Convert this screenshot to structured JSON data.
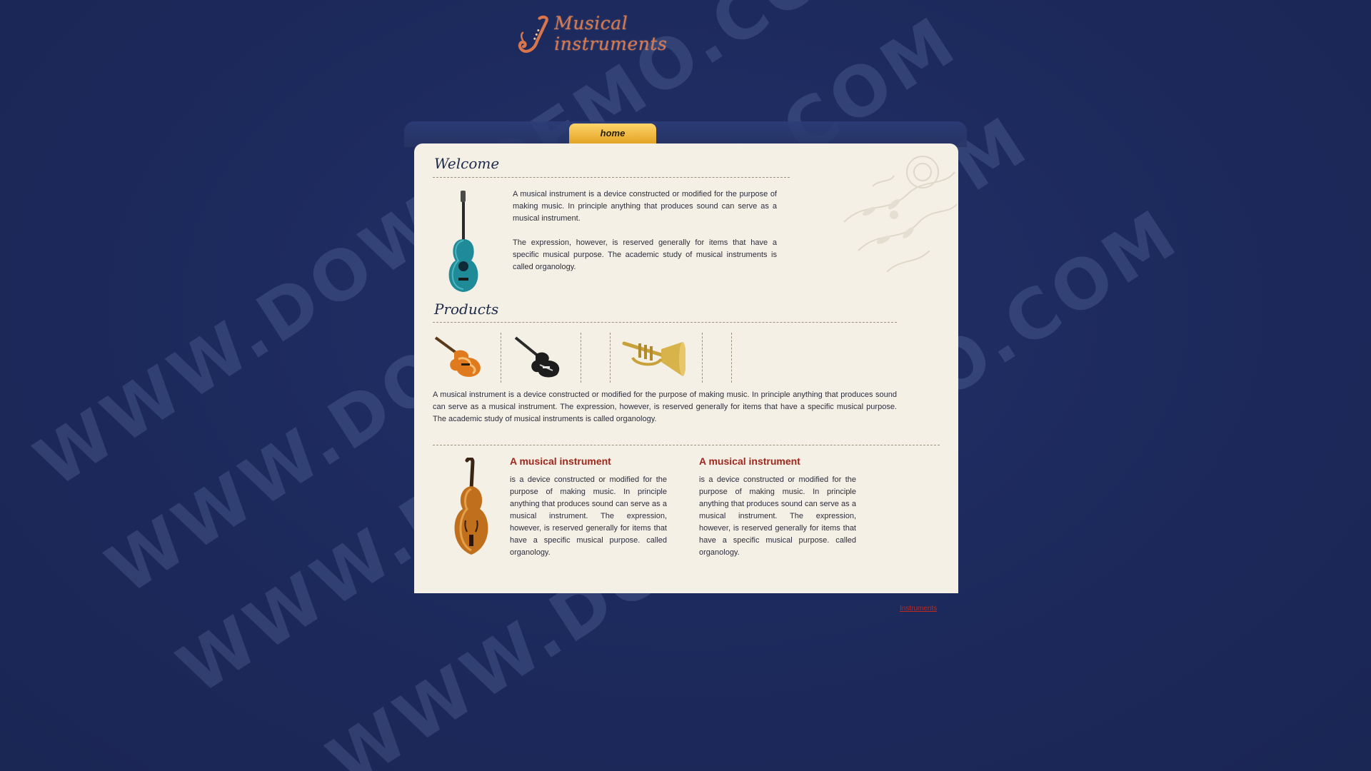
{
  "site": {
    "logo_text": "Musical instruments"
  },
  "nav": {
    "items": [
      {
        "label": "home",
        "active": true
      },
      {
        "label": "",
        "active": false
      },
      {
        "label": "",
        "active": false
      },
      {
        "label": "",
        "active": false
      }
    ]
  },
  "welcome": {
    "title": "Welcome",
    "paragraph1": "A musical instrument is a device constructed or modified for the purpose of making music. In principle anything that produces sound can serve as a musical instrument.",
    "paragraph2": "The expression, however, is reserved generally for items that have a specific musical purpose. The academic study of musical instruments is called organology."
  },
  "products": {
    "title": "Products",
    "description": "A musical instrument is a device constructed or modified for the purpose of making music. In principle anything that produces sound can serve as a musical instrument. The expression, however, is reserved generally for items that have a specific musical purpose. The academic study of musical instruments is called organology.",
    "thumbnails": [
      "electric-guitar-sunburst",
      "electric-guitar-black",
      "trumpet"
    ]
  },
  "features": [
    {
      "title": "A musical instrument",
      "text": "is a device constructed or modified for the purpose of making music. In principle anything that produces sound can serve as a musical instrument. The expression, however, is reserved generally for items that have a specific musical purpose. called organology."
    },
    {
      "title": "A musical instrument",
      "text": "is a device constructed or modified for the purpose of making music. In principle anything that produces sound can serve as a musical instrument. The expression, however, is reserved generally for items that have a specific musical purpose. called organology."
    }
  ],
  "footer": {
    "link": "Instruments"
  },
  "watermark": {
    "text": "WWW.DOWNDEMO.COM"
  },
  "colors": {
    "background": "#1c2858",
    "panel": "#f4f0e6",
    "accent_tab": "#f0b83a",
    "heading_red": "#a0271b",
    "logo": "#d97a4e"
  }
}
